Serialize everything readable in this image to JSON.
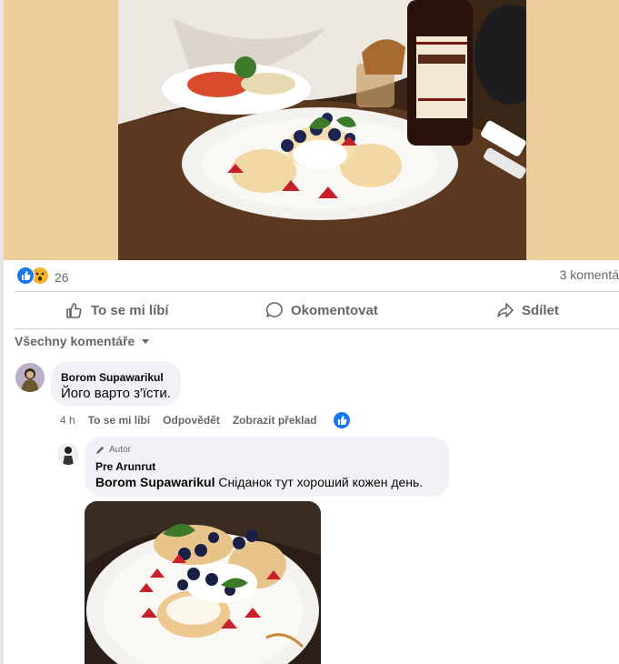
{
  "post": {
    "reactions": {
      "count": "26",
      "types": [
        "like-icon",
        "wow-icon"
      ]
    },
    "comments_count": "3 komentá",
    "actions": {
      "like": "To se mi líbí",
      "comment": "Okomentovat",
      "share": "Sdílet"
    },
    "filter": "Všechny komentáře"
  },
  "comments": [
    {
      "author": "Borom Supawarikul",
      "text": "Його варто з'їсти.",
      "time": "4 h",
      "like": "To se mi líbí",
      "reply": "Odpovědět",
      "translate": "Zobrazit překlad"
    }
  ],
  "reply": {
    "badge": "Autor",
    "author": "Pre Arunrut",
    "mention": "Borom Supawarikul",
    "text": " Сніданок тут хороший кожен день."
  },
  "colors": {
    "accent": "#1877f2",
    "bubble": "#f0f2f5",
    "band": "#eccd9c",
    "secondary_text": "#65676b"
  }
}
